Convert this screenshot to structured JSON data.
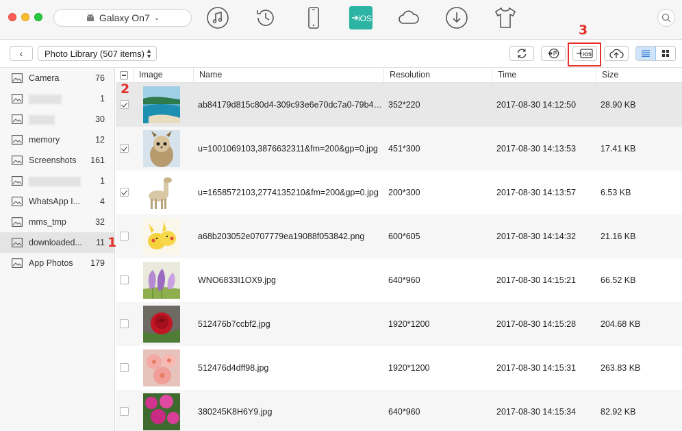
{
  "device": {
    "name": "Galaxy On7",
    "icon": "android-icon"
  },
  "nav_icons": [
    "music-icon",
    "history-icon",
    "phone-icon",
    "to-ios-icon",
    "cloud-icon",
    "download-icon",
    "tshirt-icon"
  ],
  "nav_ios_label": "iOS",
  "toolbar": {
    "library_select": "Photo Library (507 items)",
    "buttons": [
      "refresh-icon",
      "to-itunes-icon",
      "to-ios-icon",
      "upload-cloud-icon"
    ],
    "to_ios_label": "iOS",
    "view_modes": [
      "list-view-icon",
      "grid-view-icon"
    ],
    "active_view": "list"
  },
  "sidebar": {
    "items": [
      {
        "label": "Camera",
        "count": "76"
      },
      {
        "label": "",
        "count": "1",
        "redacted": true
      },
      {
        "label": "",
        "count": "30",
        "redacted": true
      },
      {
        "label": "memory",
        "count": "12"
      },
      {
        "label": "Screenshots",
        "count": "161"
      },
      {
        "label": "",
        "count": "1",
        "redacted": true
      },
      {
        "label": "WhatsApp I...",
        "count": "4"
      },
      {
        "label": "mms_tmp",
        "count": "32"
      },
      {
        "label": "downloaded...",
        "count": "11",
        "active": true
      },
      {
        "label": "App Photos",
        "count": "179"
      }
    ]
  },
  "table": {
    "columns": [
      "Image",
      "Name",
      "Resolution",
      "Time",
      "Size"
    ],
    "rows": [
      {
        "name": "ab84179d815c80d4-309c93e6e70dc7a0-79b43...",
        "resolution": "352*220",
        "time": "2017-08-30 14:12:50",
        "size": "28.90 KB",
        "checked": true,
        "thumb": "beach"
      },
      {
        "name": "u=1001069103,3876632311&fm=200&gp=0.jpg",
        "resolution": "451*300",
        "time": "2017-08-30 14:13:53",
        "size": "17.41 KB",
        "checked": true,
        "thumb": "owl"
      },
      {
        "name": "u=1658572103,2774135210&fm=200&gp=0.jpg",
        "resolution": "200*300",
        "time": "2017-08-30 14:13:57",
        "size": "6.53 KB",
        "checked": true,
        "thumb": "alpaca"
      },
      {
        "name": "a68b203052e0707779ea19088f053842.png",
        "resolution": "600*605",
        "time": "2017-08-30 14:14:32",
        "size": "21.16 KB",
        "checked": false,
        "thumb": "pikachu"
      },
      {
        "name": "WNO6833I1OX9.jpg",
        "resolution": "640*960",
        "time": "2017-08-30 14:15:21",
        "size": "66.52 KB",
        "checked": false,
        "thumb": "crocus"
      },
      {
        "name": "512476b7ccbf2.jpg",
        "resolution": "1920*1200",
        "time": "2017-08-30 14:15:28",
        "size": "204.68 KB",
        "checked": false,
        "thumb": "rose"
      },
      {
        "name": "512476d4dff98.jpg",
        "resolution": "1920*1200",
        "time": "2017-08-30 14:15:31",
        "size": "263.83 KB",
        "checked": false,
        "thumb": "pink"
      },
      {
        "name": "380245K8H6Y9.jpg",
        "resolution": "640*960",
        "time": "2017-08-30 14:15:34",
        "size": "82.92 KB",
        "checked": false,
        "thumb": "magenta"
      }
    ]
  },
  "annotations": {
    "step1": "1",
    "step2": "2",
    "step3": "3"
  },
  "colors": {
    "accent_red": "#e3302a",
    "ios_teal": "#2bb3a3",
    "selected_view": "#cfe4fa"
  }
}
